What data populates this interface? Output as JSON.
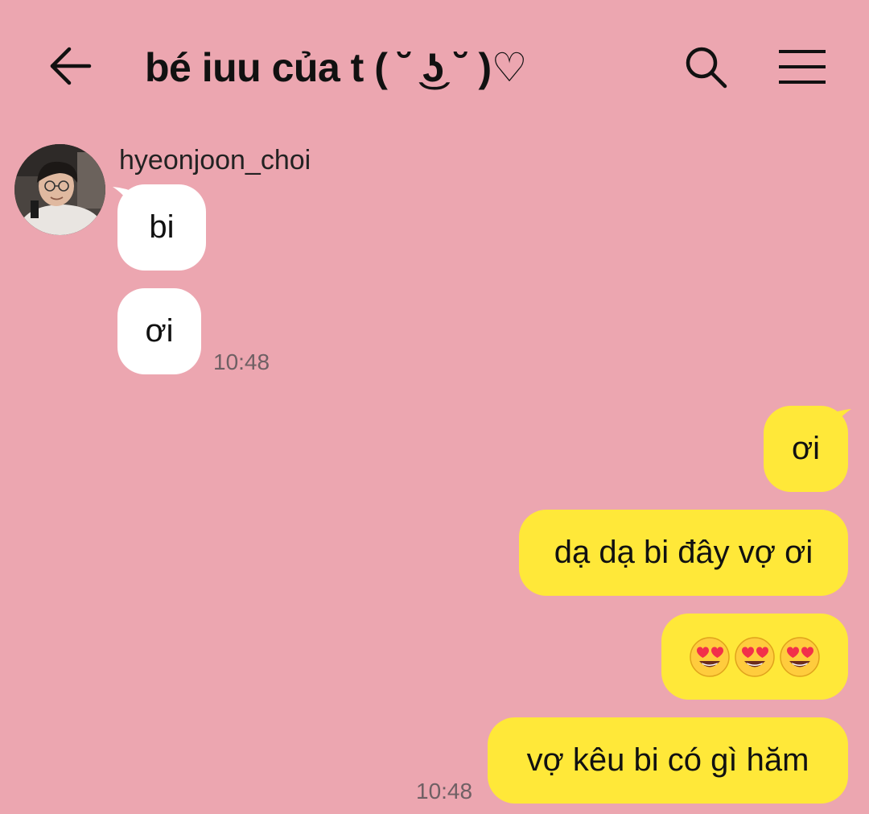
{
  "header": {
    "back_icon": "arrow-left-icon",
    "title": "bé iuu của t ( ˘ ͜ʖ ˘ )♡",
    "search_icon": "search-icon",
    "menu_icon": "hamburger-menu-icon"
  },
  "conversation": {
    "sender": {
      "name": "hyeonjoon_choi",
      "avatar": "profile-photo"
    },
    "incoming": [
      {
        "text": "bi"
      },
      {
        "text": "ơi"
      }
    ],
    "incoming_time": "10:48",
    "outgoing": [
      {
        "text": "ơi"
      },
      {
        "text": "dạ dạ bi đây vợ ơi"
      },
      {
        "emoji": "smiling-face-with-heart-eyes",
        "count": 3
      },
      {
        "text": "vợ kêu bi có gì hăm"
      }
    ],
    "outgoing_time": "10:48"
  },
  "colors": {
    "background": "#eca6b0",
    "incoming_bubble": "#ffffff",
    "outgoing_bubble": "#ffe839",
    "text": "#111111",
    "timestamp": "#6f6064"
  }
}
